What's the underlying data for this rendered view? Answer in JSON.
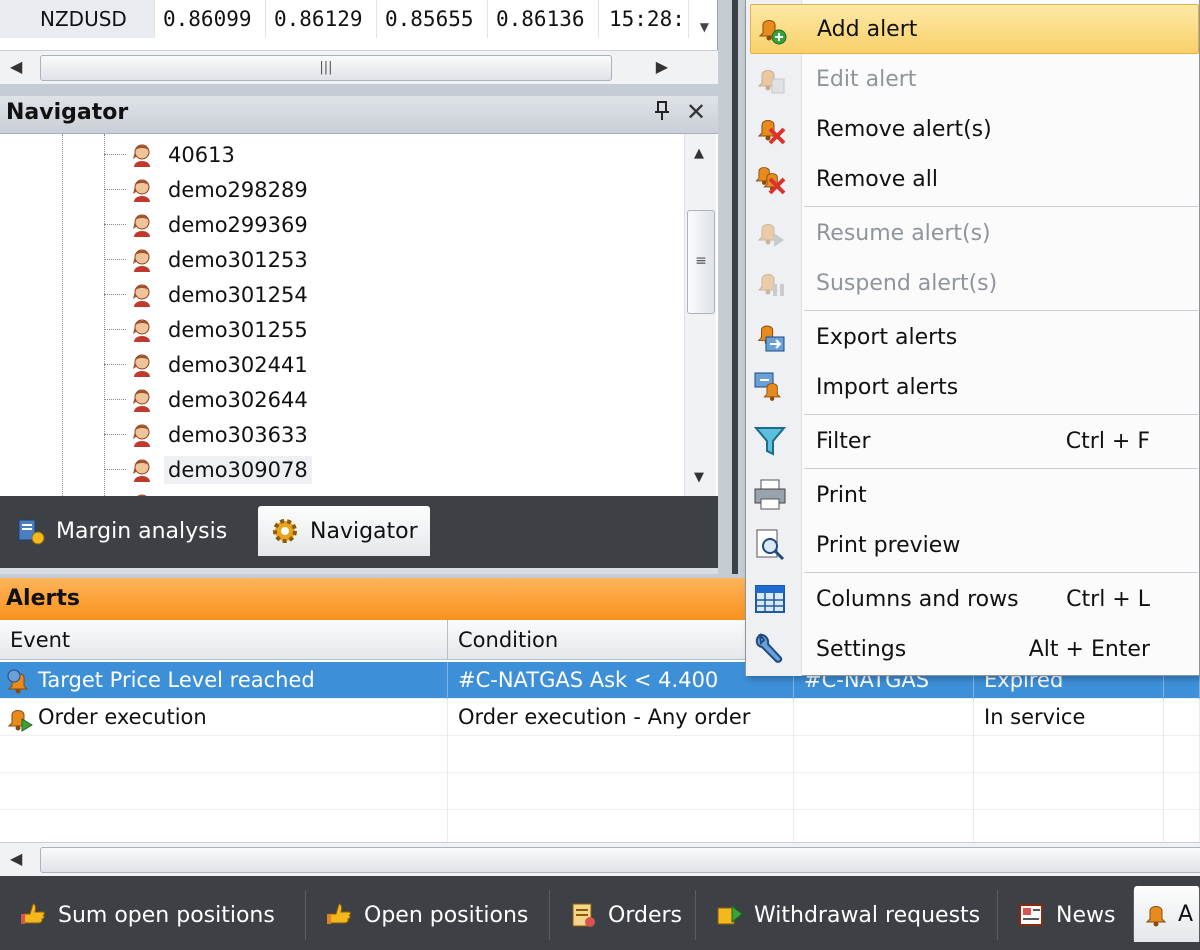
{
  "quotes": {
    "row": {
      "symbol": "NZDUSD",
      "v1": "0.86099",
      "v2": "0.86129",
      "v3": "0.85655",
      "v4": "0.86136",
      "time": "15:28:"
    }
  },
  "navigator": {
    "title": "Navigator",
    "items": [
      "40613",
      "demo298289",
      "demo299369",
      "demo301253",
      "demo301254",
      "demo301255",
      "demo302441",
      "demo302644",
      "demo303633",
      "demo309078"
    ],
    "tabs": {
      "margin": "Margin analysis",
      "navigator": "Navigator"
    }
  },
  "alerts": {
    "title": "Alerts",
    "columns": [
      "Event",
      "Condition",
      "",
      "",
      ""
    ],
    "rows": [
      {
        "event": "Target Price Level reached",
        "condition": "#C-NATGAS Ask  < 4.400",
        "instrument": "#C-NATGAS",
        "status": "Expired"
      },
      {
        "event": "Order execution",
        "condition": "Order execution - Any order",
        "instrument": "",
        "status": "In service"
      }
    ]
  },
  "bottom_tabs": [
    "Sum open positions",
    "Open positions",
    "Orders",
    "Withdrawal requests",
    "News",
    "A"
  ],
  "context_menu": {
    "items": [
      {
        "label": "Add alert",
        "shortcut": ""
      },
      {
        "label": "Edit alert",
        "shortcut": ""
      },
      {
        "label": "Remove alert(s)",
        "shortcut": ""
      },
      {
        "label": "Remove all",
        "shortcut": ""
      },
      {
        "label": "Resume alert(s)",
        "shortcut": ""
      },
      {
        "label": "Suspend alert(s)",
        "shortcut": ""
      },
      {
        "label": "Export alerts",
        "shortcut": ""
      },
      {
        "label": "Import alerts",
        "shortcut": ""
      },
      {
        "label": "Filter",
        "shortcut": "Ctrl + F"
      },
      {
        "label": "Print",
        "shortcut": ""
      },
      {
        "label": "Print preview",
        "shortcut": ""
      },
      {
        "label": "Columns and rows",
        "shortcut": "Ctrl + L"
      },
      {
        "label": "Settings",
        "shortcut": "Alt + Enter"
      }
    ]
  },
  "colors": {
    "accent_orange": "#f8921e",
    "selection_blue": "#3d8fd8",
    "menu_hover": "#f9d06a",
    "dark_strip": "#3d4044"
  },
  "icons": {
    "tree_user": "user-icon",
    "menu": [
      "add-alert-icon",
      "edit-alert-icon",
      "remove-alert-icon",
      "remove-all-icon",
      "resume-alert-icon",
      "suspend-alert-icon",
      "export-icon",
      "import-icon",
      "filter-icon",
      "printer-icon",
      "print-preview-icon",
      "grid-icon",
      "wrench-icon"
    ]
  }
}
